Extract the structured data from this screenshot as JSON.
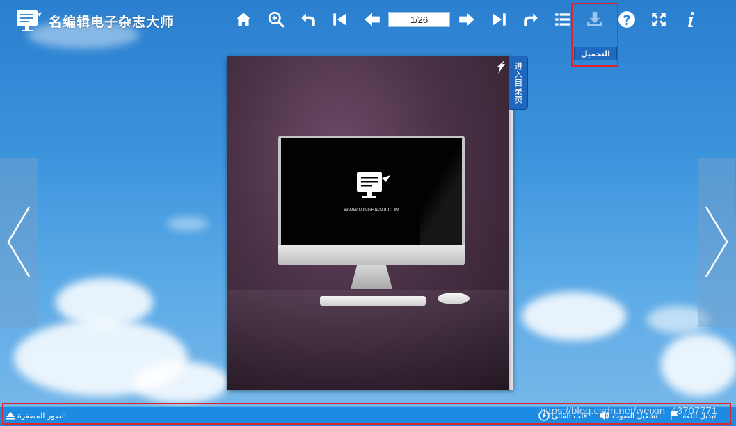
{
  "app": {
    "brand": "名编辑电子杂志大师"
  },
  "toolbar": {
    "page_indicator": "1/26",
    "download_tooltip": "التحميل"
  },
  "book": {
    "toc_tab": "进入目录页",
    "monitor_url": "WWW.MINGBIANJI.COM"
  },
  "bottom_bar": {
    "thumbnails": "الصور المصغرة",
    "auto_flip": "قلب تلقائي",
    "play_sound": "تشغيل الصوت",
    "change_language": "تبديل اللغة"
  },
  "watermark": "https://blog.csdn.net/weixin_43707771",
  "colors": {
    "accent": "#1d8be2",
    "highlight": "#e0242d",
    "tab": "#1e67bd"
  }
}
